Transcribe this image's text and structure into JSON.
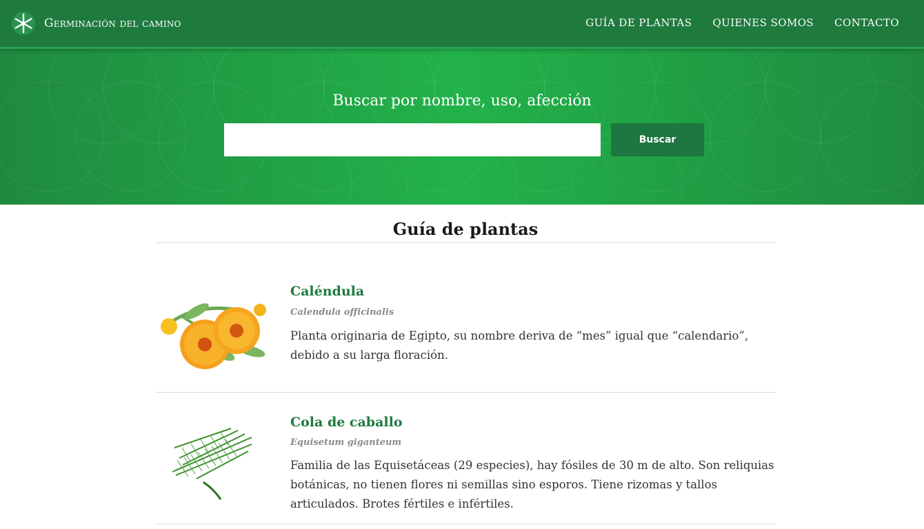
{
  "header": {
    "brand_name": "Germinación del camino",
    "logo_icon": "white-star-flower-logo",
    "nav": [
      {
        "label": "GUÍA DE PLANTAS"
      },
      {
        "label": "QUIENES SOMOS"
      },
      {
        "label": "CONTACTO"
      }
    ]
  },
  "hero": {
    "title": "Buscar por nombre, uso, afección",
    "search_value": "",
    "search_placeholder": "",
    "button_label": "Buscar"
  },
  "main": {
    "page_title": "Guía de plantas",
    "plants": [
      {
        "name": "Caléndula",
        "scientific": "Calendula officinalis",
        "description": "Planta originaria de Egipto, su nombre deriva de “mes” igual que “calendario”, debido a su larga floración.",
        "image_icon": "calendula-flowers-image"
      },
      {
        "name": "Cola de caballo",
        "scientific": "Equisetum giganteum",
        "description": "Familia de las Equisetáceas (29 especies), hay fósiles de 30 m de alto. Son reliquias botánicas, no tienen flores ni semillas sino esporos. Tiene rizomas y tallos articulados. Brotes fértiles e infértiles.",
        "image_icon": "horsetail-plant-image"
      }
    ]
  },
  "colors": {
    "nav_bg": "#1f7a3e",
    "hero_green": "#22b24a",
    "button_bg": "#1e7640",
    "plant_name": "#1f7a3e"
  }
}
